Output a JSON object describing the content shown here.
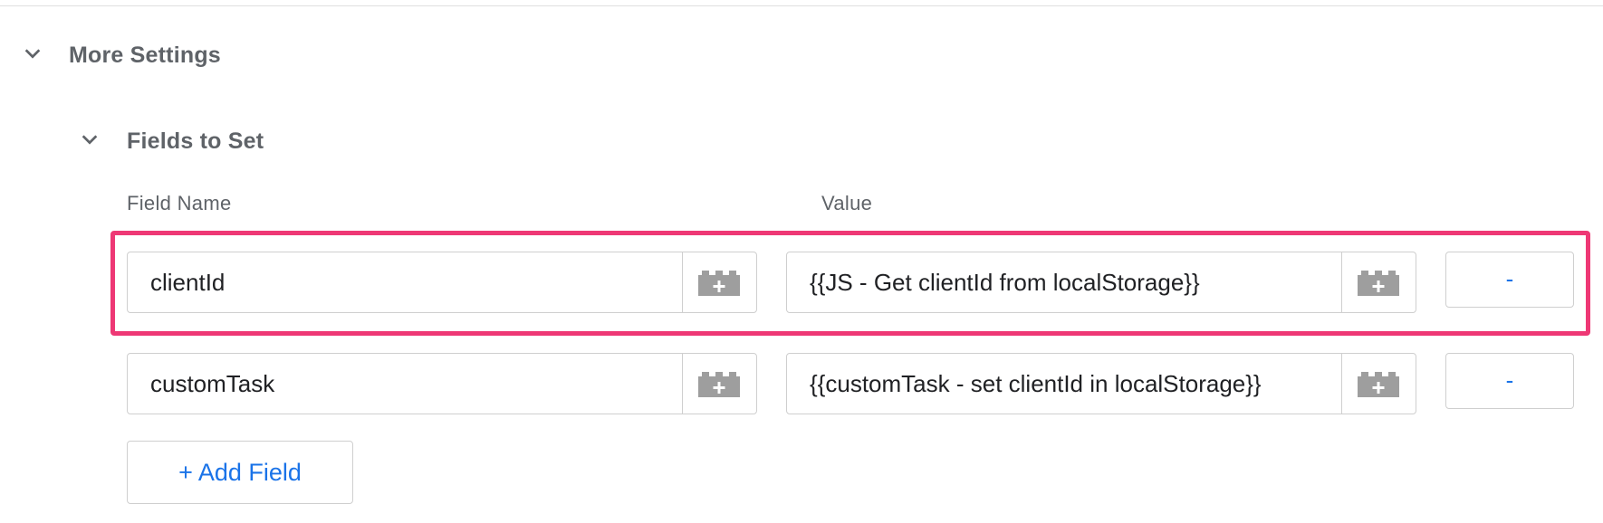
{
  "sections": {
    "more_settings": {
      "label": "More Settings",
      "icon": "chevron-down-icon"
    },
    "fields_to_set": {
      "label": "Fields to Set",
      "icon": "chevron-down-icon"
    }
  },
  "columns": {
    "field_name": "Field Name",
    "value": "Value"
  },
  "rows": [
    {
      "field_name": "clientId",
      "value": "{{JS - Get clientId from localStorage}}",
      "remove_label": "-",
      "highlighted": true
    },
    {
      "field_name": "customTask",
      "value": "{{customTask - set clientId in localStorage}}",
      "remove_label": "-",
      "highlighted": false
    }
  ],
  "add_field_label": "+ Add Field",
  "icons": {
    "variable_picker": "variable-picker-icon"
  },
  "colors": {
    "accent": "#1a73e8",
    "highlight": "#ee3875",
    "icon_gray": "#9e9e9e",
    "label_gray": "#5f6368"
  }
}
